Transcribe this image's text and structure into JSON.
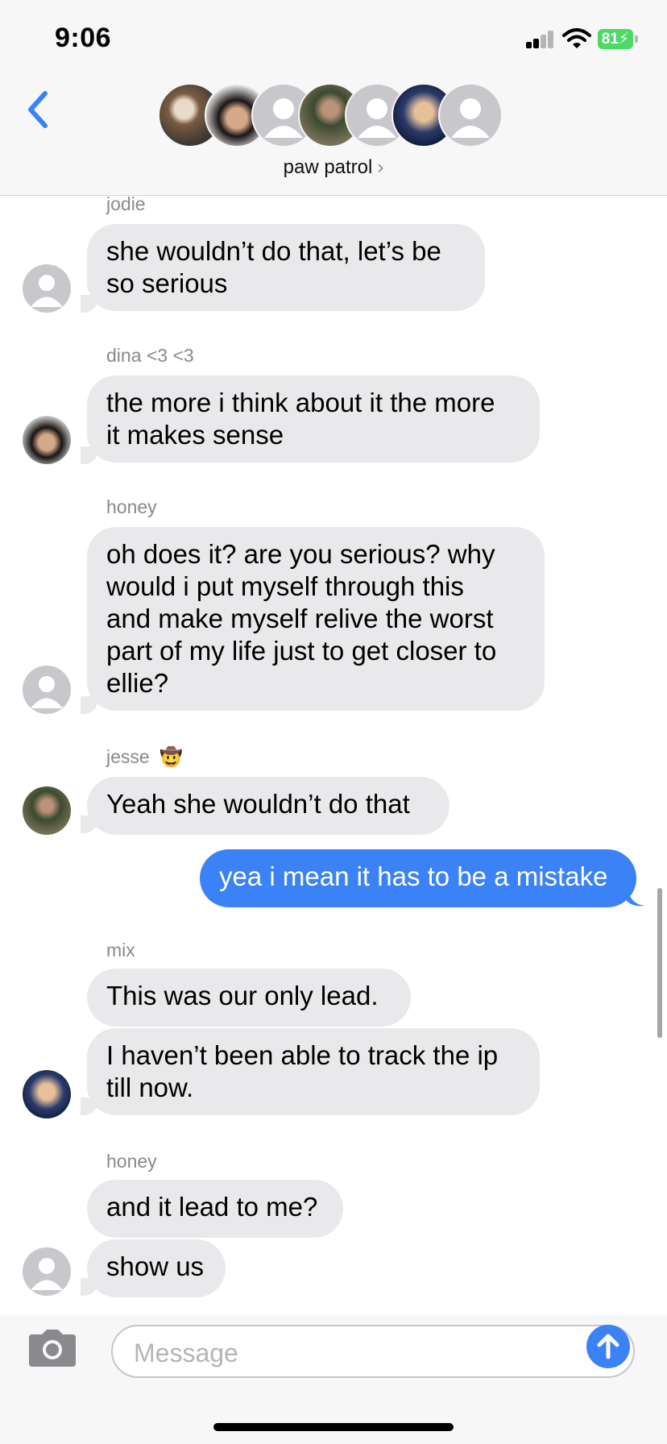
{
  "status_bar": {
    "time": "9:06",
    "battery": "81"
  },
  "header": {
    "group_name": "paw patrol",
    "chevron": "›"
  },
  "messages": {
    "m1": {
      "sender": "jodie",
      "line1": "she wouldn’t do that, let’s be",
      "line2": "so serious"
    },
    "m2": {
      "sender": "dina <3 <3",
      "line1": "the more i think about it the more",
      "line2": "it makes sense"
    },
    "m3": {
      "sender": "honey",
      "line1": "oh does it? are you serious? why",
      "line2": "would i put myself through this",
      "line3": "and make myself relive the worst",
      "line4": "part of my life just to get closer to",
      "line5": "ellie?"
    },
    "m4": {
      "sender": "jesse",
      "emoji": "🤠",
      "text": "Yeah she wouldn’t do that"
    },
    "m5": {
      "text": "yea i mean it has to be a mistake"
    },
    "m6": {
      "sender": "mix",
      "text": "This was our only lead."
    },
    "m7": {
      "line1": "I haven’t been able to track the ip",
      "line2": "till now."
    },
    "m8": {
      "sender": "honey",
      "text": "and it lead to me?"
    },
    "m9": {
      "text": "show us"
    }
  },
  "composer": {
    "placeholder": "Message"
  },
  "colors": {
    "accent": "#3b82f6",
    "received_bubble": "#e9e9eb",
    "battery": "#4cd964"
  },
  "icons": [
    "back-chevron-icon",
    "camera-icon",
    "send-arrow-icon",
    "wifi-icon",
    "signal-icon"
  ]
}
